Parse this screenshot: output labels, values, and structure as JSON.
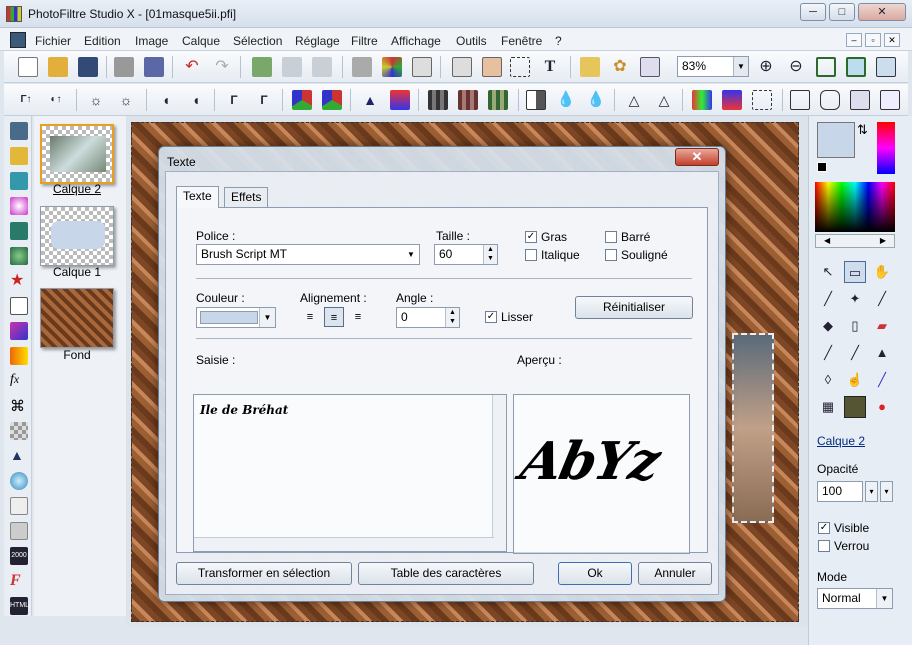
{
  "window": {
    "title": "PhotoFiltre Studio X - [01masque5ii.pfi]",
    "btn_min": "─",
    "btn_max": "□",
    "btn_close": "✕"
  },
  "menu": {
    "items": [
      "Fichier",
      "Edition",
      "Image",
      "Calque",
      "Sélection",
      "Réglage",
      "Filtre",
      "Affichage",
      "Outils",
      "Fenêtre",
      "?"
    ],
    "mdi_min": "–",
    "mdi_max": "▫",
    "mdi_close": "✕"
  },
  "toolbar": {
    "zoom": "83%"
  },
  "layers": [
    {
      "name": "Calque 2",
      "active": true
    },
    {
      "name": "Calque 1"
    },
    {
      "name": "Fond"
    }
  ],
  "dialog": {
    "title": "Texte",
    "close": "✕",
    "tabs": [
      "Texte",
      "Effets"
    ],
    "police_label": "Police :",
    "police_value": "Brush Script MT",
    "taille_label": "Taille :",
    "taille_value": "60",
    "styles": [
      {
        "label": "Gras",
        "checked": true
      },
      {
        "label": "Barré",
        "checked": false
      },
      {
        "label": "Italique",
        "checked": false
      },
      {
        "label": "Souligné",
        "checked": false
      }
    ],
    "couleur_label": "Couleur :",
    "couleur_value": "#c8d6ea",
    "alignement_label": "Alignement :",
    "angle_label": "Angle :",
    "angle_value": "0",
    "lisser_label": "Lisser",
    "lisser_checked": true,
    "reset_label": "Réinitialiser",
    "saisie_label": "Saisie :",
    "saisie_text": "Ile de Bréhat",
    "apercu_label": "Aperçu :",
    "apercu_text": "AbYz",
    "btn_transform": "Transformer en sélection",
    "btn_table": "Table des caractères",
    "btn_ok": "Ok",
    "btn_cancel": "Annuler"
  },
  "right_panel": {
    "layer_name": "Calque 2",
    "opacity_label": "Opacité",
    "opacity_value": "100",
    "visible_label": "Visible",
    "visible_checked": true,
    "verrou_label": "Verrou",
    "verrou_checked": false,
    "mode_label": "Mode",
    "mode_value": "Normal",
    "fg_color": "#c8d6ea",
    "bg_color": "#000000"
  }
}
